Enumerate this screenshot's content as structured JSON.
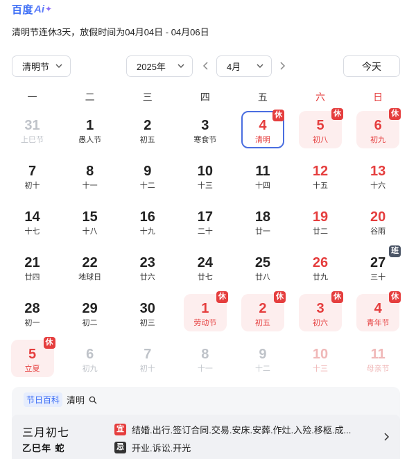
{
  "brand": {
    "name_cn": "百度",
    "name_ai": "Ai",
    "spark": "✦"
  },
  "notice": "清明节连休3天，放假时间为04月04日 - 04月06日",
  "toolbar": {
    "holiday_select": "清明节",
    "year_select": "2025年",
    "month_select": "4月",
    "today_button": "今天"
  },
  "icons": {
    "chevron_down": "chevron-down-icon",
    "prev_month": "chevron-left-icon",
    "next_month": "chevron-right-icon",
    "search": "search-icon",
    "more": "chevron-right-icon"
  },
  "colors": {
    "accent": "#3a6cf6",
    "holiday": "#e53e3e",
    "holiday_bg": "#fdeeee",
    "work_badge": "#4b5566",
    "selected_border": "#4a6ee0"
  },
  "weekdays": [
    "一",
    "二",
    "三",
    "四",
    "五",
    "六",
    "日"
  ],
  "days": [
    {
      "d": "31",
      "sub": "上巳节",
      "dim": true
    },
    {
      "d": "1",
      "sub": "愚人节"
    },
    {
      "d": "2",
      "sub": "初五"
    },
    {
      "d": "3",
      "sub": "寒食节"
    },
    {
      "d": "4",
      "sub": "清明",
      "selected": true,
      "badge": "休"
    },
    {
      "d": "5",
      "sub": "初八",
      "holiday": true,
      "badge": "休"
    },
    {
      "d": "6",
      "sub": "初九",
      "holiday": true,
      "badge": "休"
    },
    {
      "d": "7",
      "sub": "初十"
    },
    {
      "d": "8",
      "sub": "十一"
    },
    {
      "d": "9",
      "sub": "十二"
    },
    {
      "d": "10",
      "sub": "十三"
    },
    {
      "d": "11",
      "sub": "十四"
    },
    {
      "d": "12",
      "sub": "十五"
    },
    {
      "d": "13",
      "sub": "十六"
    },
    {
      "d": "14",
      "sub": "十七"
    },
    {
      "d": "15",
      "sub": "十八"
    },
    {
      "d": "16",
      "sub": "十九"
    },
    {
      "d": "17",
      "sub": "二十"
    },
    {
      "d": "18",
      "sub": "廿一"
    },
    {
      "d": "19",
      "sub": "廿二"
    },
    {
      "d": "20",
      "sub": "谷雨"
    },
    {
      "d": "21",
      "sub": "廿四"
    },
    {
      "d": "22",
      "sub": "地球日"
    },
    {
      "d": "23",
      "sub": "廿六"
    },
    {
      "d": "24",
      "sub": "廿七"
    },
    {
      "d": "25",
      "sub": "廿八"
    },
    {
      "d": "26",
      "sub": "廿九"
    },
    {
      "d": "27",
      "sub": "三十",
      "badge": "班",
      "work": true,
      "black": true
    },
    {
      "d": "28",
      "sub": "初一"
    },
    {
      "d": "29",
      "sub": "初二"
    },
    {
      "d": "30",
      "sub": "初三"
    },
    {
      "d": "1",
      "sub": "劳动节",
      "holiday": true,
      "badge": "休"
    },
    {
      "d": "2",
      "sub": "初五",
      "holiday": true,
      "badge": "休"
    },
    {
      "d": "3",
      "sub": "初六",
      "holiday": true,
      "badge": "休"
    },
    {
      "d": "4",
      "sub": "青年节",
      "holiday": true,
      "badge": "休"
    },
    {
      "d": "5",
      "sub": "立夏",
      "holiday": true,
      "badge": "休"
    },
    {
      "d": "6",
      "sub": "初九",
      "dim": true
    },
    {
      "d": "7",
      "sub": "初十",
      "dim": true
    },
    {
      "d": "8",
      "sub": "十一",
      "dim": true
    },
    {
      "d": "9",
      "sub": "十二",
      "dim": true
    },
    {
      "d": "10",
      "sub": "十三",
      "dim": true
    },
    {
      "d": "11",
      "sub": "母亲节",
      "dim": true
    }
  ],
  "footer": {
    "tag": "节日百科",
    "keyword": "清明",
    "lunar_date": "三月初七",
    "year_label": "乙巳年 蛇",
    "yi_mark": "宜",
    "yi": "结婚.出行.签订合同.交易.安床.安葬.作灶.入殓.移柩.成...",
    "ji_mark": "忌",
    "ji": "开业.诉讼.开光"
  }
}
